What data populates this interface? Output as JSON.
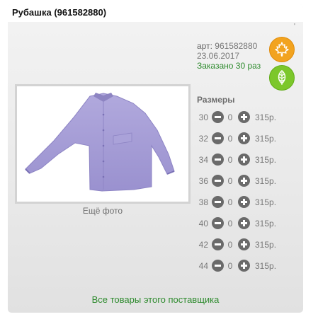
{
  "product": {
    "title": "Рубашка (961582880)",
    "tick_mark": "'",
    "article_label": "арт:",
    "article_value": "961582880",
    "date": "23.06.2017",
    "ordered_text": "Заказано 30 раз"
  },
  "badges": [
    {
      "icon": "maple-leaf-icon",
      "color": "#f2a31f"
    },
    {
      "icon": "green-leaf-icon",
      "color": "#7cc72b"
    }
  ],
  "photo": {
    "more_photos_label": "Ещё фото"
  },
  "sizes": {
    "title": "Размеры",
    "rows": [
      {
        "size": "30",
        "qty": "0",
        "price": "315р."
      },
      {
        "size": "32",
        "qty": "0",
        "price": "315р."
      },
      {
        "size": "34",
        "qty": "0",
        "price": "315р."
      },
      {
        "size": "36",
        "qty": "0",
        "price": "315р."
      },
      {
        "size": "38",
        "qty": "0",
        "price": "315р."
      },
      {
        "size": "40",
        "qty": "0",
        "price": "315р."
      },
      {
        "size": "42",
        "qty": "0",
        "price": "315р."
      },
      {
        "size": "44",
        "qty": "0",
        "price": "315р."
      }
    ]
  },
  "footer": {
    "supplier_link": "Все товары этого поставщика"
  },
  "colors": {
    "accent_green": "#2e8b2e",
    "badge_orange": "#f2a31f",
    "badge_green": "#7cc72b"
  }
}
